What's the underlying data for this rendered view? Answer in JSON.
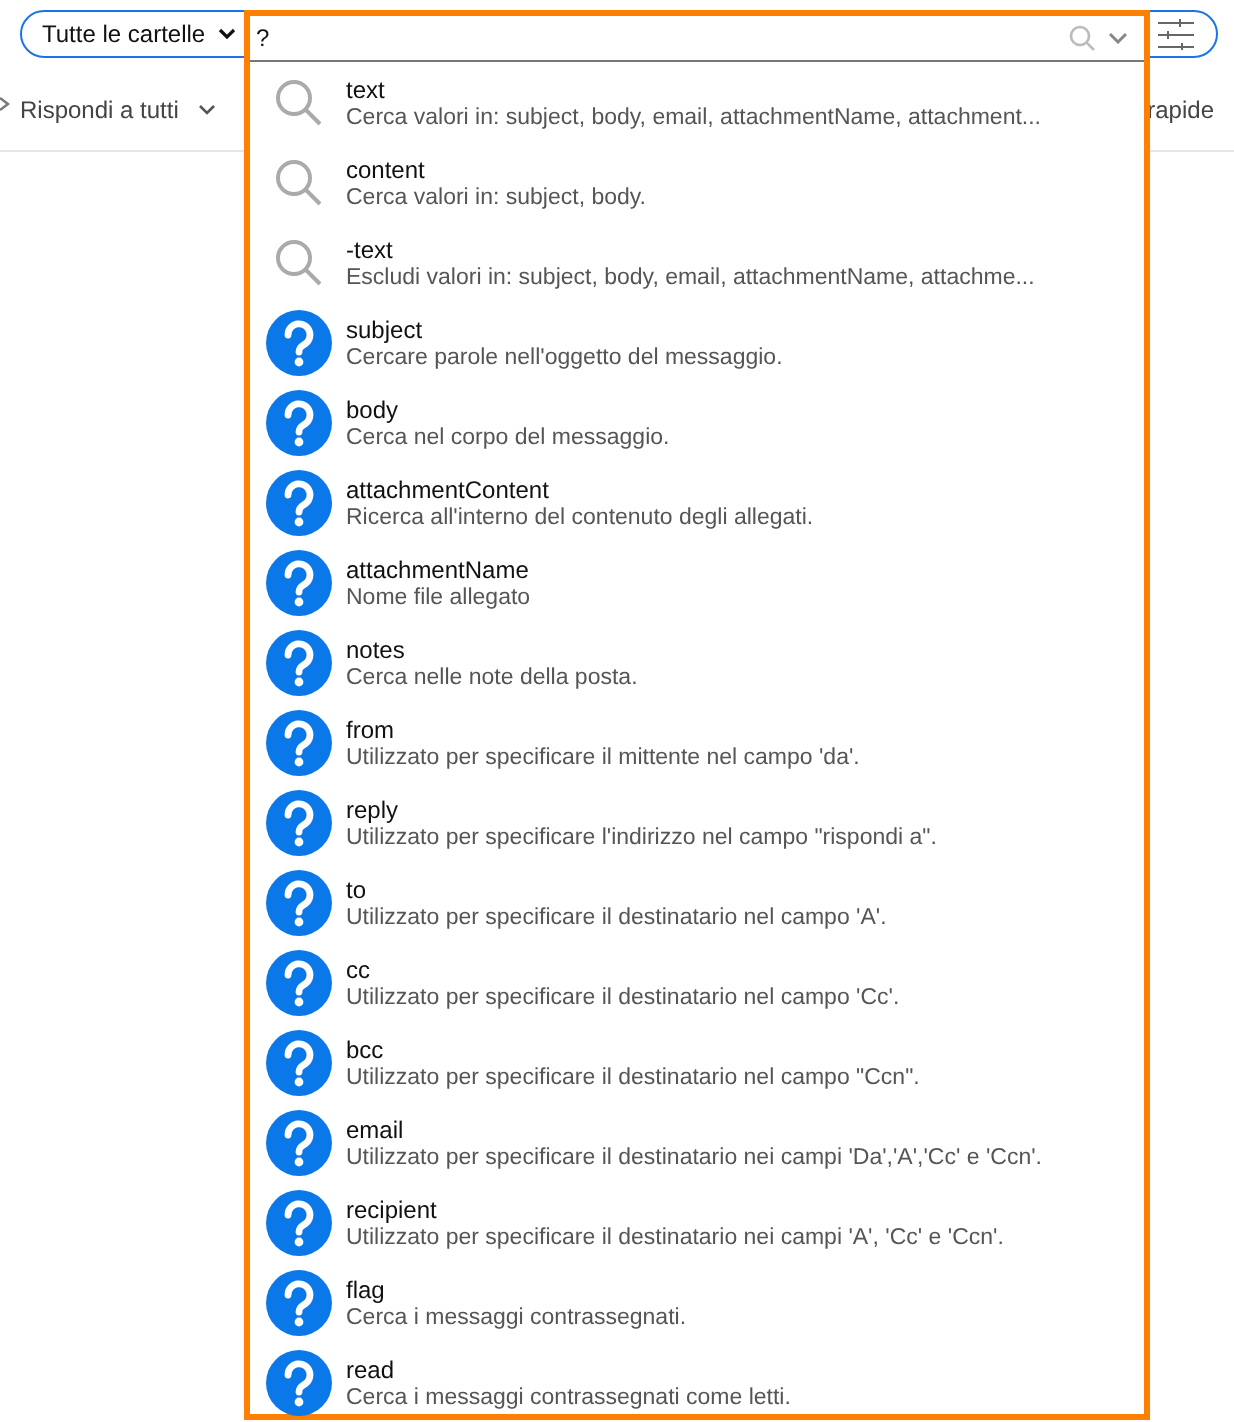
{
  "search_bar": {
    "scope": "Tutte le cartelle",
    "query": "?"
  },
  "toolbar": {
    "reply_all": "Rispondi a tutti",
    "right_label": "rapide"
  },
  "suggestions": [
    {
      "kind": "search",
      "title": "text",
      "description": "Cerca valori in: subject, body, email, attachmentName, attachment..."
    },
    {
      "kind": "search",
      "title": "content",
      "description": "Cerca valori in: subject, body."
    },
    {
      "kind": "search",
      "title": "-text",
      "description": "Escludi valori in: subject, body, email, attachmentName, attachme..."
    },
    {
      "kind": "help",
      "title": "subject",
      "description": "Cercare parole nell'oggetto del messaggio."
    },
    {
      "kind": "help",
      "title": "body",
      "description": "Cerca nel corpo del messaggio."
    },
    {
      "kind": "help",
      "title": "attachmentContent",
      "description": "Ricerca all'interno del contenuto degli allegati."
    },
    {
      "kind": "help",
      "title": "attachmentName",
      "description": "Nome file allegato"
    },
    {
      "kind": "help",
      "title": "notes",
      "description": "Cerca nelle note della posta."
    },
    {
      "kind": "help",
      "title": "from",
      "description": "Utilizzato per specificare il mittente nel campo 'da'."
    },
    {
      "kind": "help",
      "title": "reply",
      "description": "Utilizzato per specificare l'indirizzo nel campo \"rispondi a\"."
    },
    {
      "kind": "help",
      "title": "to",
      "description": "Utilizzato per specificare il destinatario nel campo 'A'."
    },
    {
      "kind": "help",
      "title": "cc",
      "description": "Utilizzato per specificare il destinatario nel campo 'Cc'."
    },
    {
      "kind": "help",
      "title": "bcc",
      "description": "Utilizzato per specificare il destinatario nel campo \"Ccn\"."
    },
    {
      "kind": "help",
      "title": "email",
      "description": "Utilizzato per specificare il destinatario nei campi 'Da','A','Cc' e 'Ccn'."
    },
    {
      "kind": "help",
      "title": "recipient",
      "description": "Utilizzato per specificare il destinatario nei campi 'A', 'Cc' e 'Ccn'."
    },
    {
      "kind": "help",
      "title": "flag",
      "description": "Cerca i messaggi contrassegnati."
    },
    {
      "kind": "help",
      "title": "read",
      "description": "Cerca i messaggi contrassegnati come letti."
    }
  ]
}
